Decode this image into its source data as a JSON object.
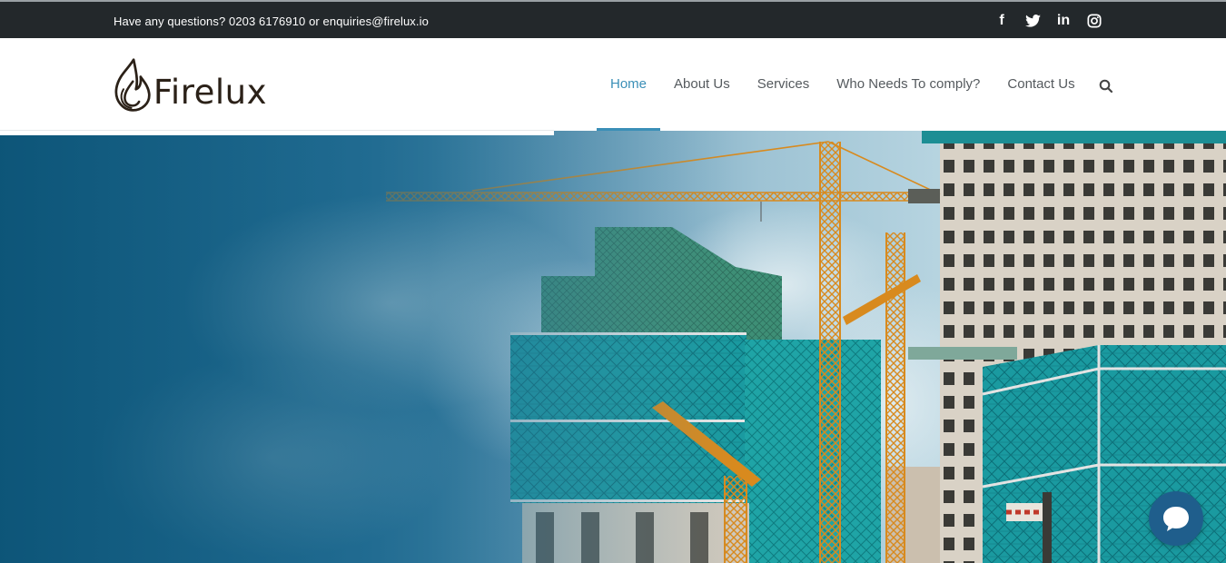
{
  "topbar": {
    "contact_text": "Have any questions? 0203 6176910 or enquiries@firelux.io",
    "social": [
      {
        "icon": "facebook-icon",
        "glyph": "f"
      },
      {
        "icon": "twitter-icon"
      },
      {
        "icon": "linkedin-icon",
        "glyph": "in"
      },
      {
        "icon": "instagram-icon"
      }
    ]
  },
  "header": {
    "logo_text": "Firelux",
    "nav": [
      {
        "label": "Home",
        "active": true
      },
      {
        "label": "About Us"
      },
      {
        "label": "Services"
      },
      {
        "label": "Who Needs To comply?"
      },
      {
        "label": "Contact Us"
      }
    ],
    "search_icon": "search-icon"
  },
  "hero": {
    "image": "construction-site-with-cranes"
  },
  "chat": {
    "icon": "chat-bubble-icon"
  },
  "colors": {
    "topbar_bg": "#23282b",
    "accent": "#3a8fb7",
    "nav_text": "#555a5e",
    "chat_button": "#1f5e8c"
  }
}
